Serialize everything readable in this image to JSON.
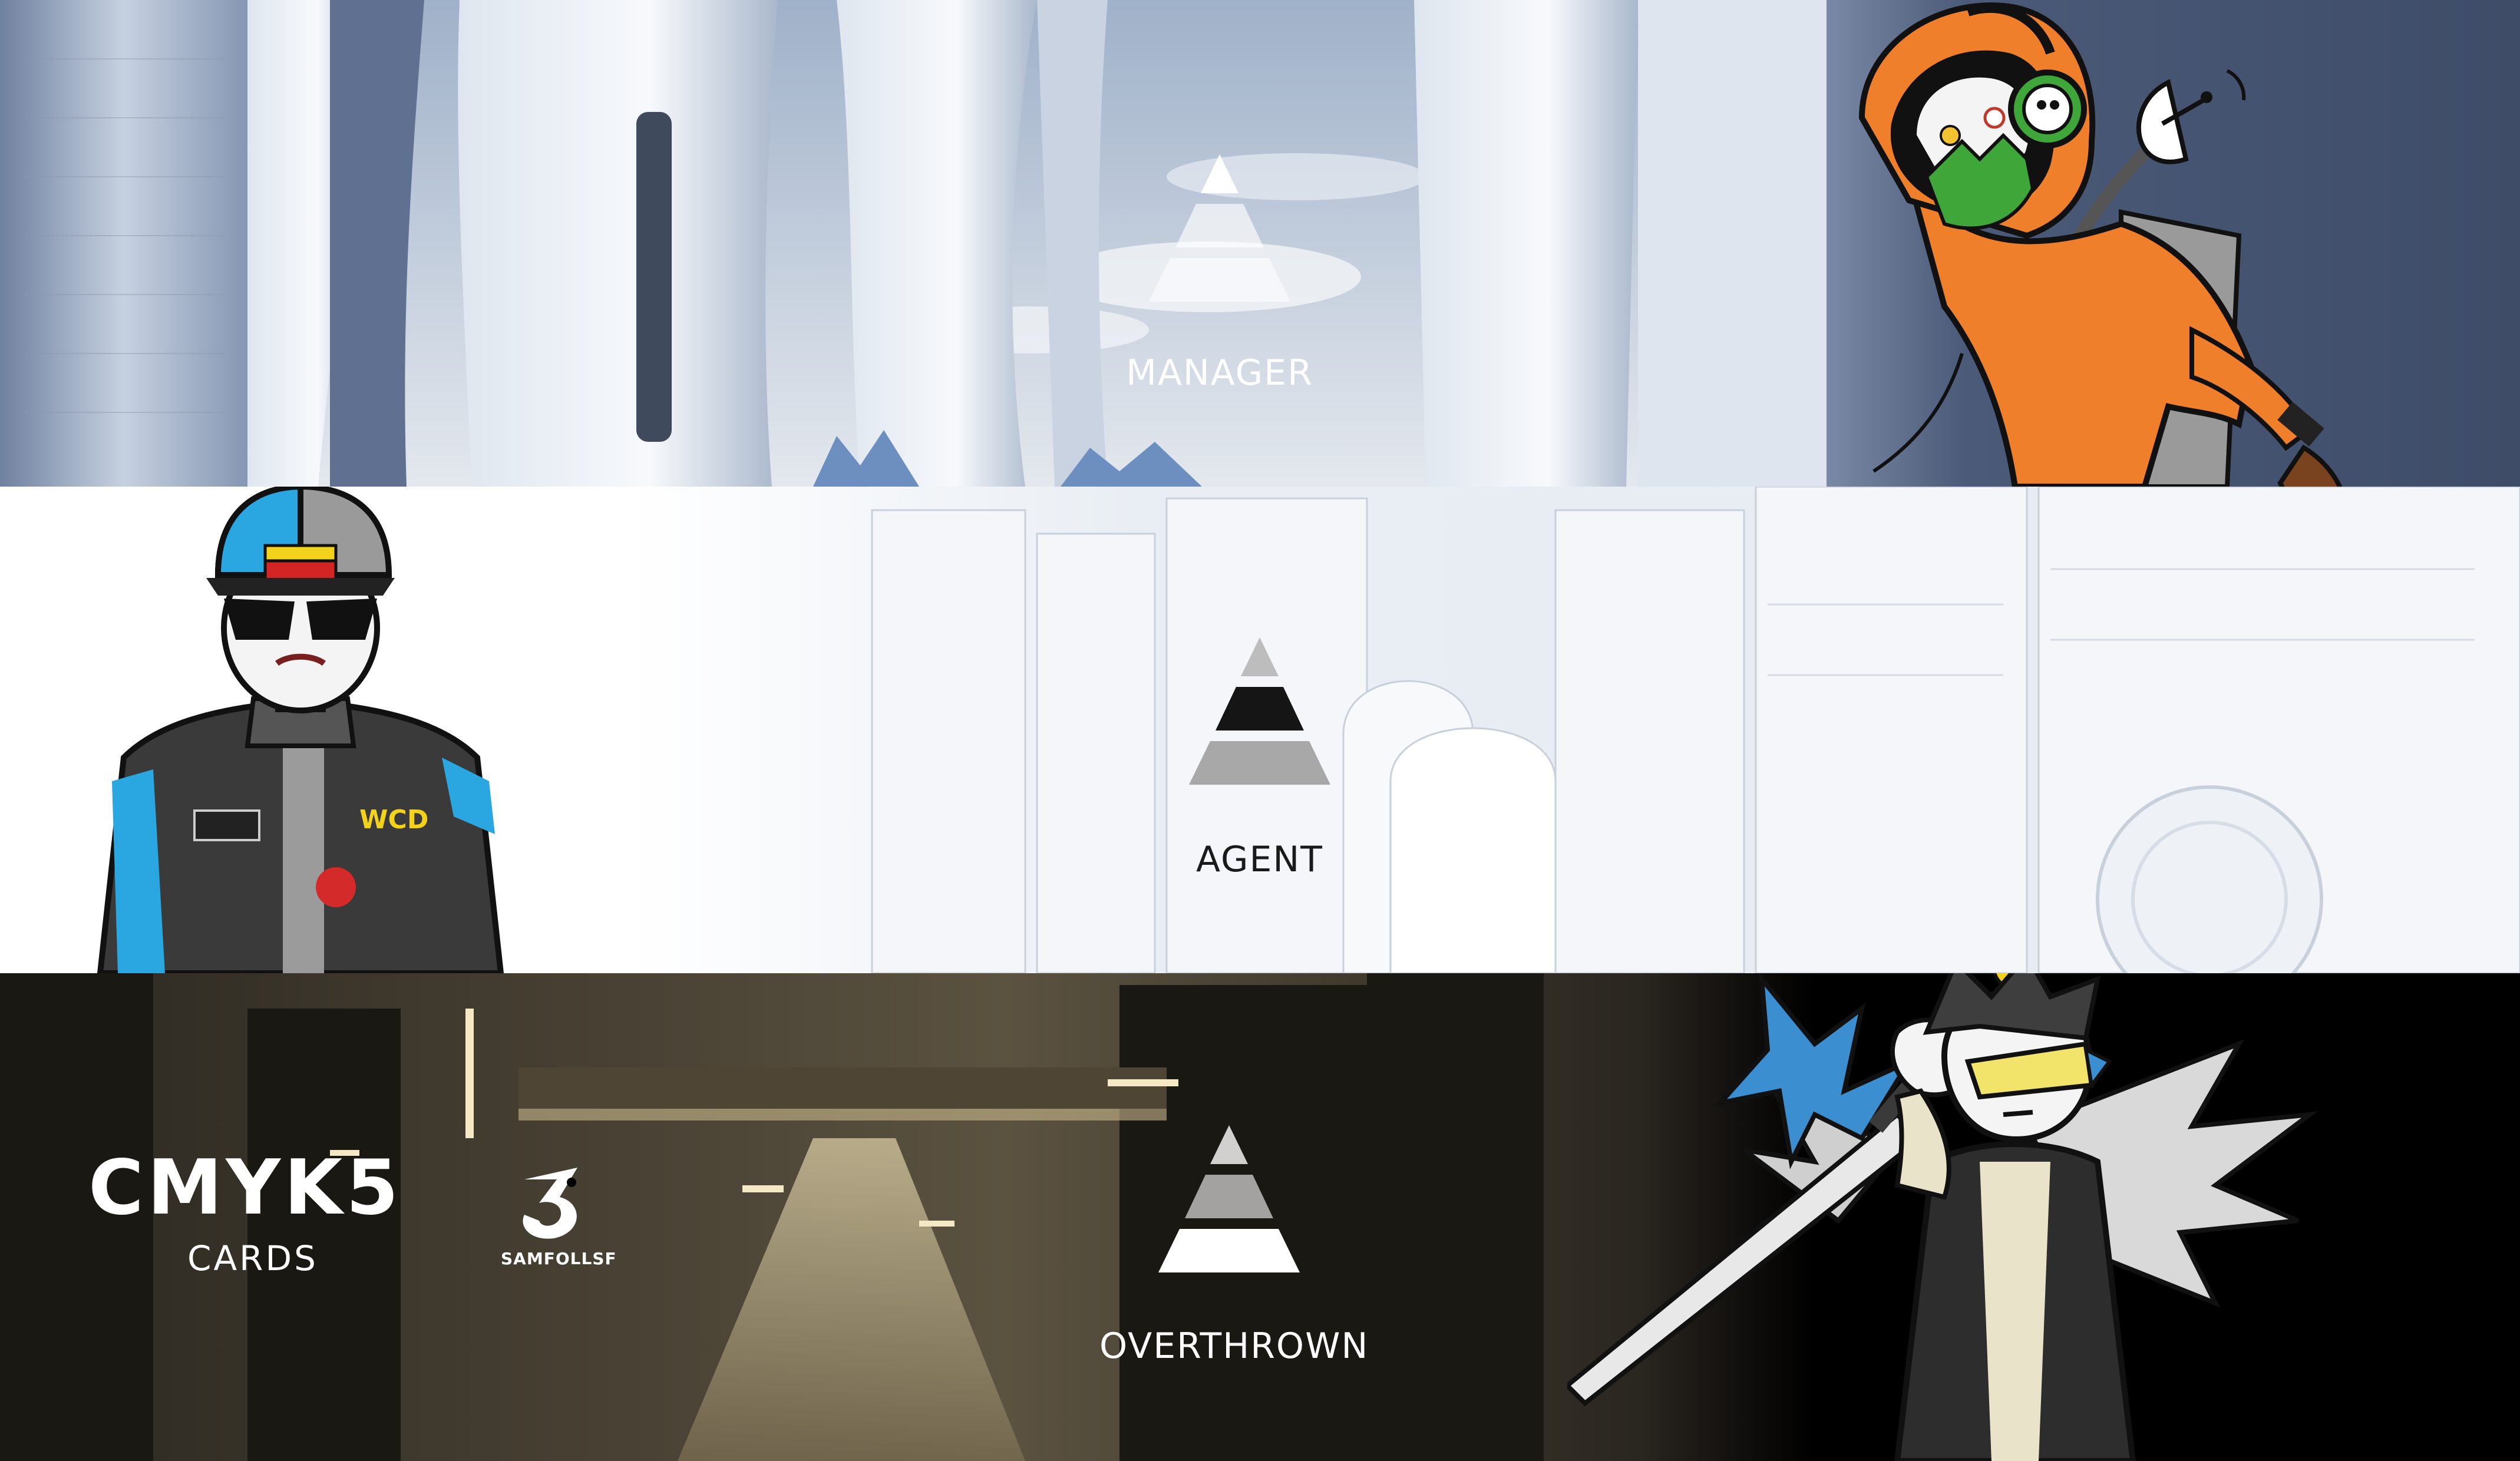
{
  "ranks": {
    "manager": {
      "label": "MANAGER"
    },
    "agent": {
      "label": "AGENT"
    },
    "overthrown": {
      "label": "OVERTHROWN"
    }
  },
  "brand": {
    "title": "CMYK5",
    "subtitle": "CARDS",
    "studio": "SAMFOLLSF"
  },
  "jacket_text": {
    "sponsor": "WCD"
  },
  "colors": {
    "sky_top": "#9fb1c9",
    "sky_bottom": "#e4e8ee",
    "dark_panel": "#4a5a78",
    "white_city": "#eef2f7",
    "dark_city": "#1a1813",
    "hoodie_orange": "#f07f2c",
    "mask_green": "#3fa63a",
    "racer_blue": "#2aa7e0",
    "sword_blue": "#3b8fd0",
    "visor_yellow": "#f2e36b"
  },
  "icons": [
    "pyramid-rank-icon",
    "samfollsf-logo-icon",
    "satellite-dish-icon",
    "headphones-icon"
  ]
}
